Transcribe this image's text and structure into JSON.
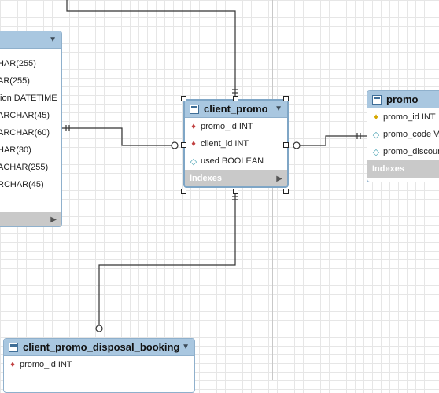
{
  "tables": {
    "left_partial": {
      "rows": [
        "HAR(255)",
        "AR(255)",
        "tion DATETIME",
        "ARCHAR(45)",
        "ARCHAR(60)",
        "HAR(30)",
        "ACHAR(255)",
        "RCHAR(45)"
      ]
    },
    "client_promo": {
      "name": "client_promo",
      "columns": [
        {
          "key": "fk",
          "text": "promo_id INT"
        },
        {
          "key": "fk",
          "text": "client_id INT"
        },
        {
          "key": "col",
          "text": "used BOOLEAN"
        }
      ],
      "indexes_label": "Indexes"
    },
    "promo": {
      "name": "promo",
      "columns": [
        {
          "key": "pk",
          "text": "promo_id INT"
        },
        {
          "key": "col",
          "text": "promo_code VA"
        },
        {
          "key": "col",
          "text": "promo_discount"
        }
      ],
      "indexes_label": "Indexes"
    },
    "client_promo_disposal_booking": {
      "name": "client_promo_disposal_booking",
      "columns": [
        {
          "key": "fk",
          "text": "promo_id INT"
        }
      ]
    }
  },
  "icons": {
    "table": "table-icon",
    "pk": "primary-key-icon",
    "fk": "foreign-key-icon",
    "column": "column-diamond-icon",
    "collapse": "collapse-arrow-icon",
    "expand": "expand-arrow-icon"
  },
  "colors": {
    "header": "#a9c7e0",
    "border": "#8fb0cc",
    "indexes": "#c9c9c9",
    "grid": "#e6e6e6"
  }
}
